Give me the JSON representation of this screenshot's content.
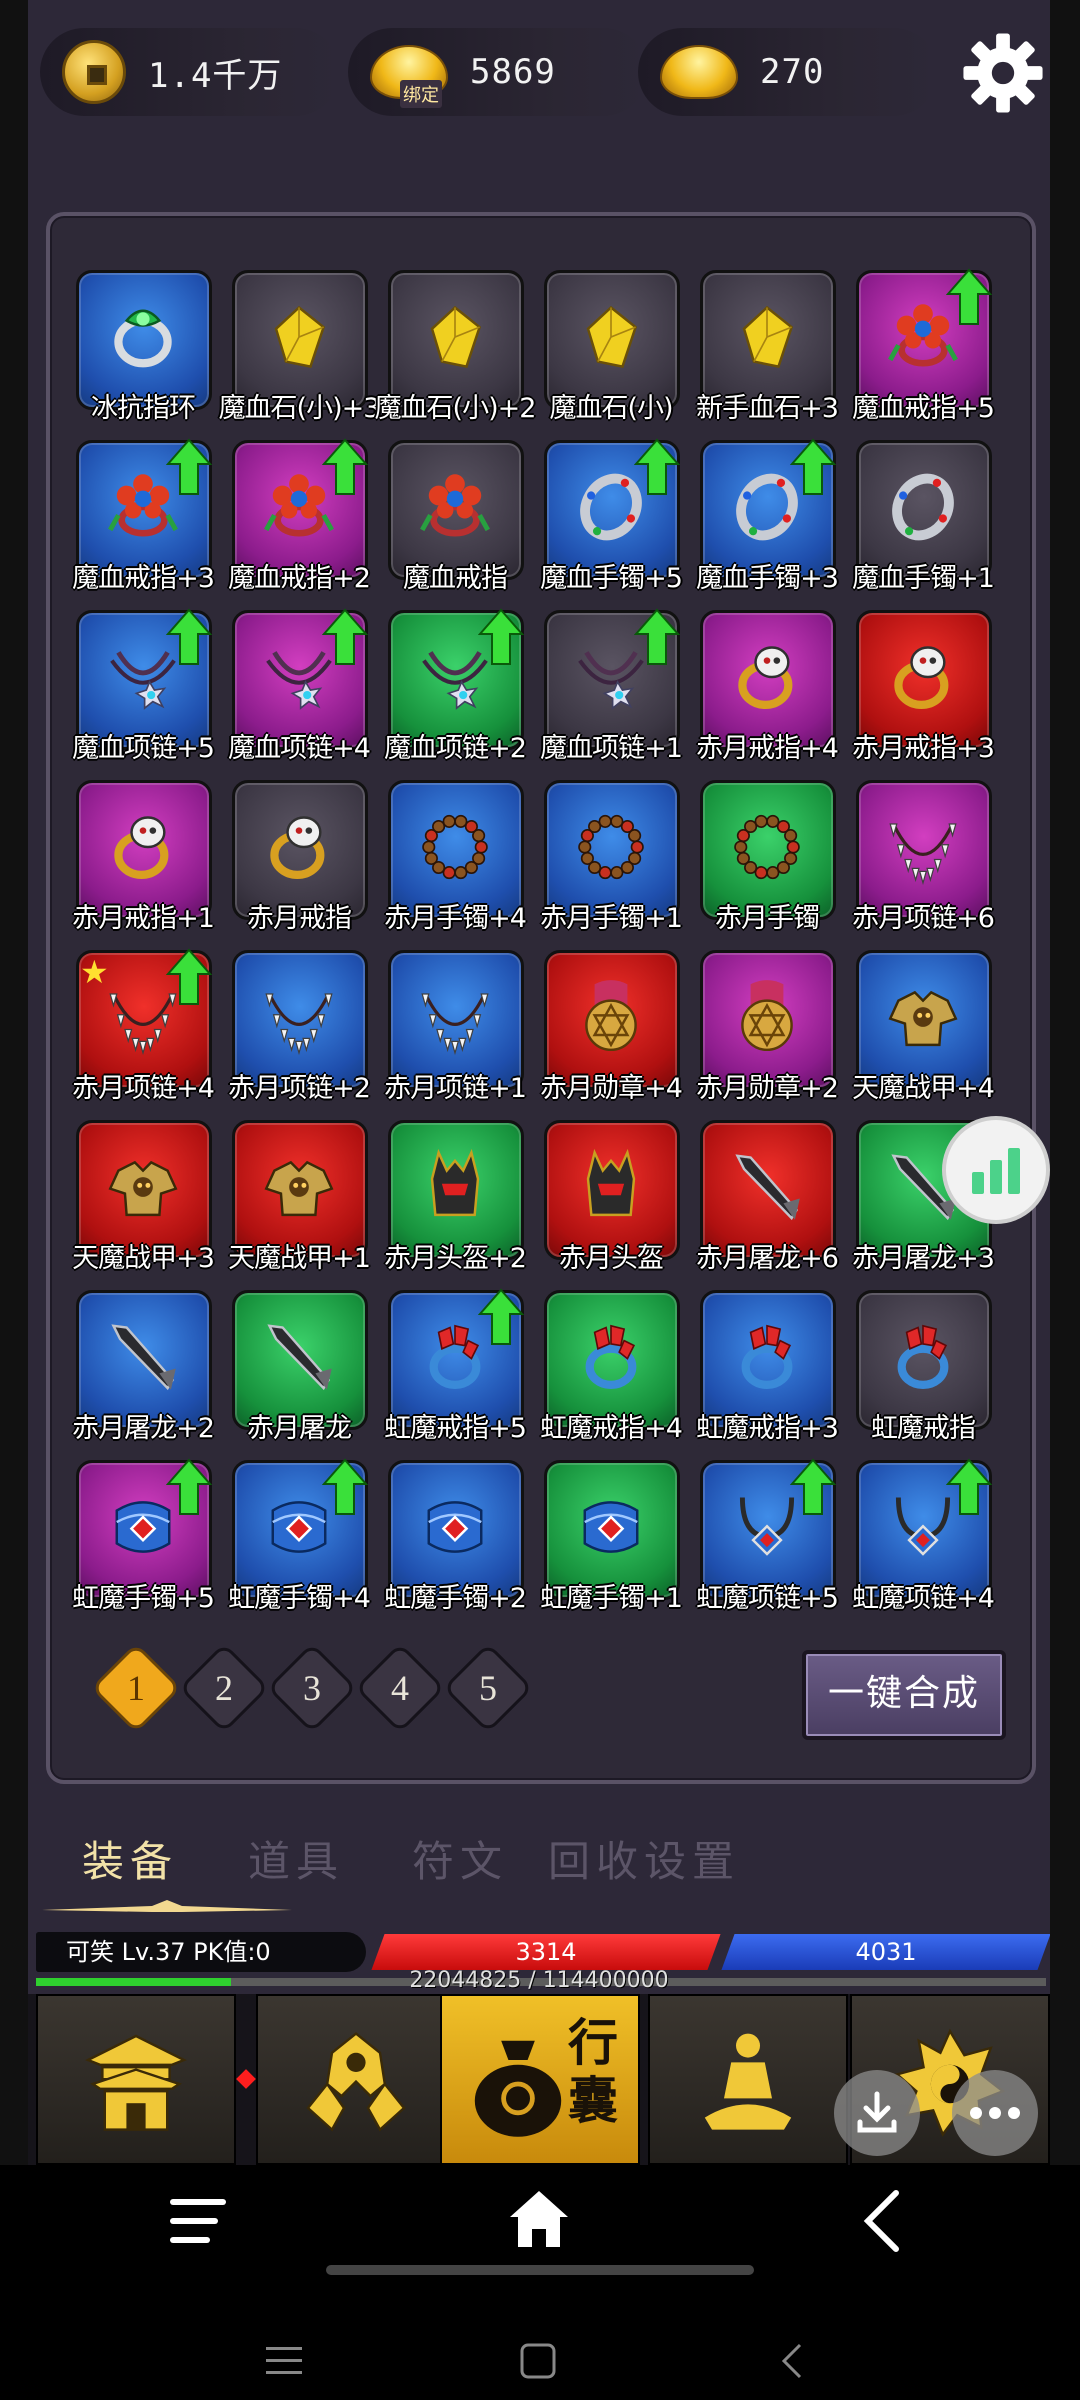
{
  "currencies": [
    {
      "icon": "copper-coin-icon",
      "value": "1.4千万"
    },
    {
      "icon": "gold-ingot-bound-icon",
      "value": "5869",
      "tag": "绑定"
    },
    {
      "icon": "gold-ingot-icon",
      "value": "270"
    }
  ],
  "inventory": {
    "items": [
      {
        "name": "冰抗指环",
        "quality": "blue",
        "icon": "ring-icon",
        "upgrade": false
      },
      {
        "name": "魔血石(小)+3",
        "quality": "gray",
        "icon": "gem-icon",
        "upgrade": false
      },
      {
        "name": "魔血石(小)+2",
        "quality": "gray",
        "icon": "gem-icon",
        "upgrade": false
      },
      {
        "name": "魔血石(小)",
        "quality": "gray",
        "icon": "gem-icon",
        "upgrade": false
      },
      {
        "name": "新手血石+3",
        "quality": "gray",
        "icon": "gem-icon",
        "upgrade": false
      },
      {
        "name": "魔血戒指+5",
        "quality": "purple",
        "icon": "flower-ring-icon",
        "upgrade": true
      },
      {
        "name": "魔血戒指+3",
        "quality": "blue",
        "icon": "flower-ring-icon",
        "upgrade": true
      },
      {
        "name": "魔血戒指+2",
        "quality": "purple",
        "icon": "flower-ring-icon",
        "upgrade": true
      },
      {
        "name": "魔血戒指",
        "quality": "gray",
        "icon": "flower-ring-icon",
        "upgrade": false
      },
      {
        "name": "魔血手镯+5",
        "quality": "blue",
        "icon": "bracelet-icon",
        "upgrade": true
      },
      {
        "name": "魔血手镯+3",
        "quality": "blue",
        "icon": "bracelet-icon",
        "upgrade": true
      },
      {
        "name": "魔血手镯+1",
        "quality": "gray",
        "icon": "bracelet-icon",
        "upgrade": false
      },
      {
        "name": "魔血项链+5",
        "quality": "blue",
        "icon": "necklace-icon",
        "upgrade": true
      },
      {
        "name": "魔血项链+4",
        "quality": "purple",
        "icon": "necklace-icon",
        "upgrade": true
      },
      {
        "name": "魔血项链+2",
        "quality": "green",
        "icon": "necklace-icon",
        "upgrade": true
      },
      {
        "name": "魔血项链+1",
        "quality": "gray",
        "icon": "necklace-icon",
        "upgrade": true
      },
      {
        "name": "赤月戒指+4",
        "quality": "purple",
        "icon": "skull-ring-icon",
        "upgrade": false
      },
      {
        "name": "赤月戒指+3",
        "quality": "red",
        "icon": "skull-ring-icon",
        "upgrade": false
      },
      {
        "name": "赤月戒指+1",
        "quality": "purple",
        "icon": "skull-ring-icon",
        "upgrade": false
      },
      {
        "name": "赤月戒指",
        "quality": "gray",
        "icon": "skull-ring-icon",
        "upgrade": false
      },
      {
        "name": "赤月手镯+4",
        "quality": "blue",
        "icon": "bead-bracelet-icon",
        "upgrade": false
      },
      {
        "name": "赤月手镯+1",
        "quality": "blue",
        "icon": "bead-bracelet-icon",
        "upgrade": false
      },
      {
        "name": "赤月手镯",
        "quality": "green",
        "icon": "bead-bracelet-icon",
        "upgrade": false
      },
      {
        "name": "赤月项链+6",
        "quality": "purple",
        "icon": "fang-necklace-icon",
        "upgrade": false
      },
      {
        "name": "赤月项链+4",
        "quality": "red",
        "icon": "fang-necklace-icon",
        "upgrade": true,
        "star": true
      },
      {
        "name": "赤月项链+2",
        "quality": "blue",
        "icon": "fang-necklace-icon",
        "upgrade": false
      },
      {
        "name": "赤月项链+1",
        "quality": "blue",
        "icon": "fang-necklace-icon",
        "upgrade": false
      },
      {
        "name": "赤月勋章+4",
        "quality": "red",
        "icon": "hexagram-medal-icon",
        "upgrade": false
      },
      {
        "name": "赤月勋章+2",
        "quality": "purple",
        "icon": "hexagram-medal-icon",
        "upgrade": false
      },
      {
        "name": "天魔战甲+4",
        "quality": "blue",
        "icon": "armor-icon",
        "upgrade": false
      },
      {
        "name": "天魔战甲+3",
        "quality": "red",
        "icon": "armor-icon",
        "upgrade": false
      },
      {
        "name": "天魔战甲+1",
        "quality": "red",
        "icon": "armor-icon",
        "upgrade": false
      },
      {
        "name": "赤月头盔+2",
        "quality": "green",
        "icon": "helmet-icon",
        "upgrade": false
      },
      {
        "name": "赤月头盔",
        "quality": "red",
        "icon": "helmet-icon",
        "upgrade": false
      },
      {
        "name": "赤月屠龙+6",
        "quality": "red",
        "icon": "sword-icon",
        "upgrade": false
      },
      {
        "name": "赤月屠龙+3",
        "quality": "green",
        "icon": "sword-icon",
        "upgrade": false
      },
      {
        "name": "赤月屠龙+2",
        "quality": "blue",
        "icon": "sword-icon",
        "upgrade": false
      },
      {
        "name": "赤月屠龙",
        "quality": "green",
        "icon": "sword-icon",
        "upgrade": false
      },
      {
        "name": "虹魔戒指+5",
        "quality": "blue",
        "icon": "ruby-ring-icon",
        "upgrade": true
      },
      {
        "name": "虹魔戒指+4",
        "quality": "green",
        "icon": "ruby-ring-icon",
        "upgrade": false
      },
      {
        "name": "虹魔戒指+3",
        "quality": "blue",
        "icon": "ruby-ring-icon",
        "upgrade": false
      },
      {
        "name": "虹魔戒指",
        "quality": "gray",
        "icon": "ruby-ring-icon",
        "upgrade": false
      },
      {
        "name": "虹魔手镯+5",
        "quality": "purple",
        "icon": "cuff-bracelet-icon",
        "upgrade": true
      },
      {
        "name": "虹魔手镯+4",
        "quality": "blue",
        "icon": "cuff-bracelet-icon",
        "upgrade": true
      },
      {
        "name": "虹魔手镯+2",
        "quality": "blue",
        "icon": "cuff-bracelet-icon",
        "upgrade": false
      },
      {
        "name": "虹魔手镯+1",
        "quality": "green",
        "icon": "cuff-bracelet-icon",
        "upgrade": false
      },
      {
        "name": "虹魔项链+5",
        "quality": "blue",
        "icon": "pendant-necklace-icon",
        "upgrade": true
      },
      {
        "name": "虹魔项链+4",
        "quality": "blue",
        "icon": "pendant-necklace-icon",
        "upgrade": true
      }
    ],
    "pages": [
      "1",
      "2",
      "3",
      "4",
      "5"
    ],
    "active_page": "1",
    "merge_label": "一键合成"
  },
  "tabs": [
    {
      "label": "装备",
      "active": true
    },
    {
      "label": "道具",
      "active": false
    },
    {
      "label": "符文",
      "active": false
    },
    {
      "label": "回收设置",
      "active": false
    }
  ],
  "player": {
    "name_level": "可笑  Lv.37 PK值:0",
    "hp": "3314",
    "mp": "4031",
    "exp_text": "22044825 / 114400000",
    "exp_fraction": 0.193
  },
  "bottom_nav": [
    {
      "icon": "palace-icon",
      "active": false
    },
    {
      "icon": "warrior-helmet-icon",
      "active": false
    },
    {
      "icon": "bag-icon",
      "label": "行囊",
      "active": true
    },
    {
      "icon": "meditation-icon",
      "active": false
    },
    {
      "icon": "yin-yang-icon",
      "active": false
    }
  ],
  "colors": {
    "blue": "#1f4fae",
    "purple": "#8c1c8c",
    "green": "#16913c",
    "red": "#b01010",
    "gray": "#3c3744",
    "hp": "#e41818",
    "mp": "#2a50d8",
    "exp": "#2fd02f",
    "accent_gold": "#f0a81c"
  }
}
